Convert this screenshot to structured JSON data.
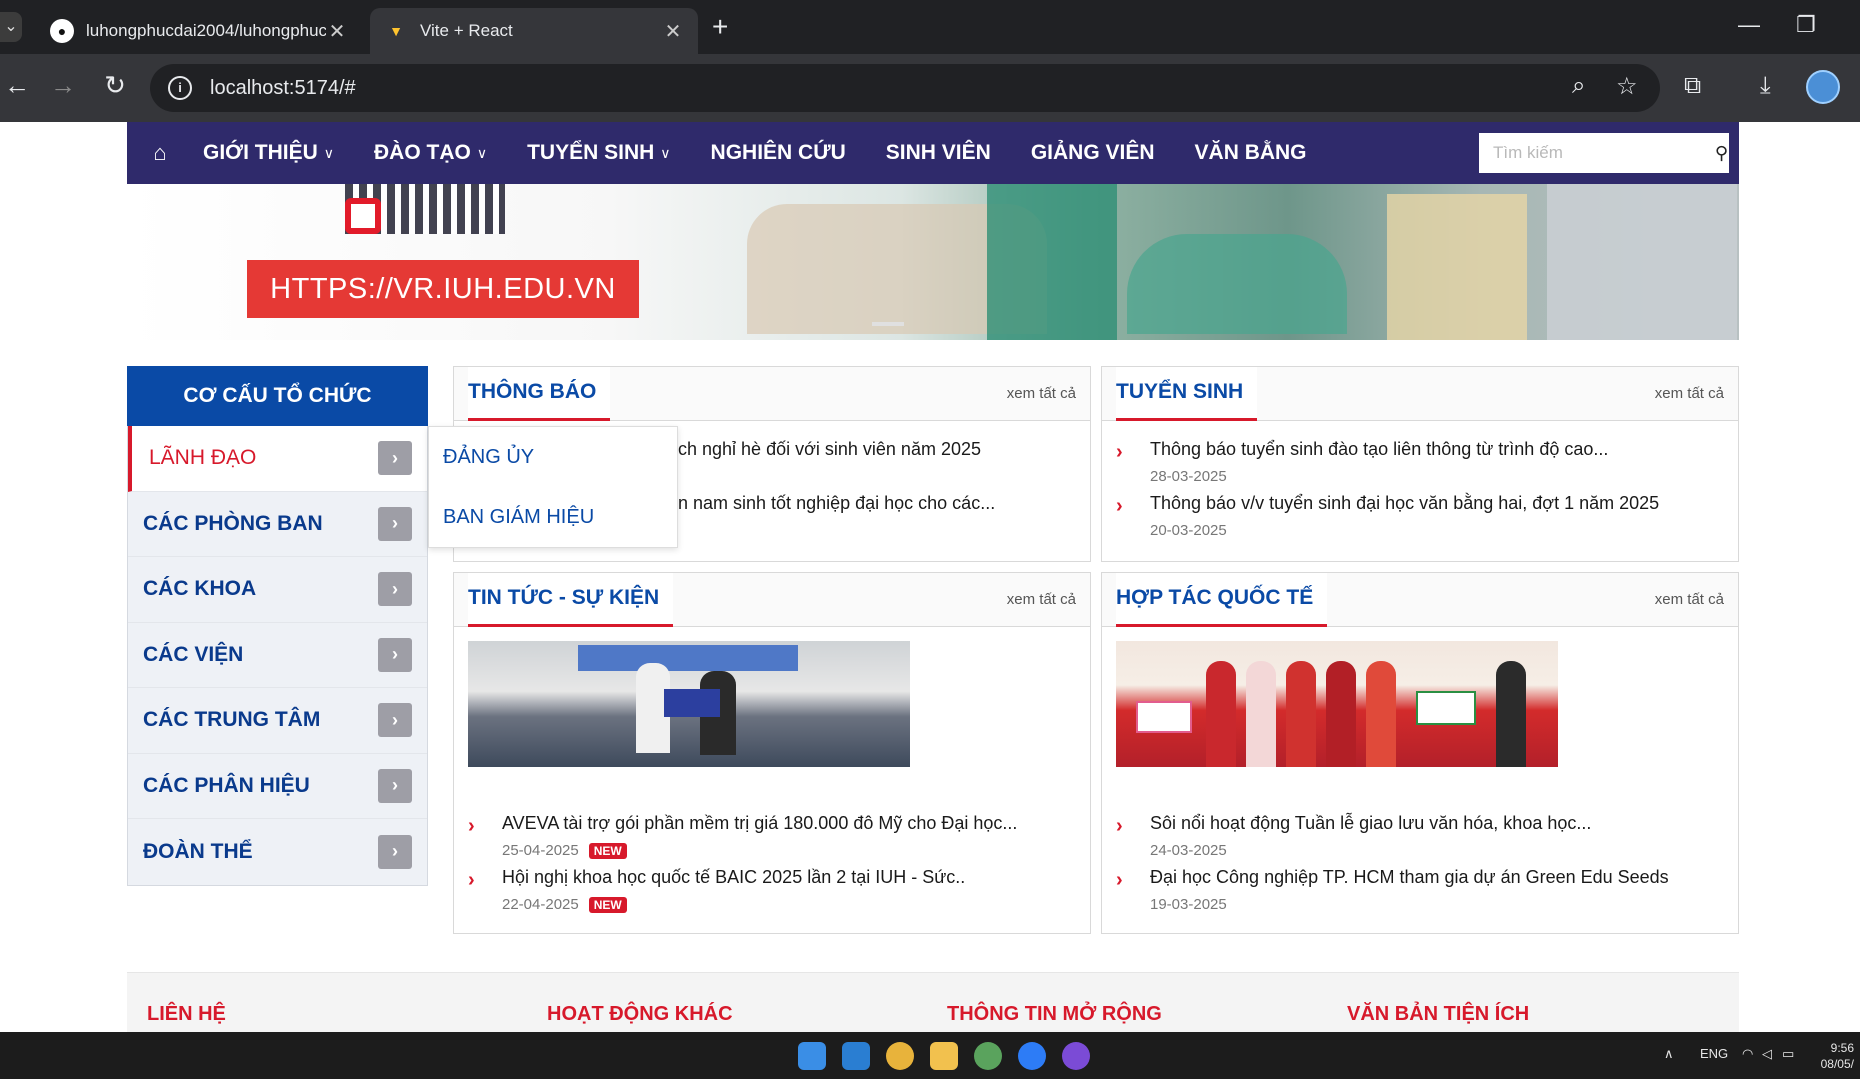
{
  "browser": {
    "tabs": [
      {
        "title": "luhongphucdai2004/luhongphucd",
        "active": false
      },
      {
        "title": "Vite + React",
        "active": true
      }
    ],
    "url": "localhost:5174/#"
  },
  "nav": {
    "items": [
      {
        "label": "GIỚI THIỆU",
        "dropdown": true
      },
      {
        "label": "ĐÀO TẠO",
        "dropdown": true
      },
      {
        "label": "TUYỂN SINH",
        "dropdown": true
      },
      {
        "label": "NGHIÊN CỨU",
        "dropdown": false
      },
      {
        "label": "SINH VIÊN",
        "dropdown": false
      },
      {
        "label": "GIẢNG VIÊN",
        "dropdown": false
      },
      {
        "label": "VĂN BẰNG",
        "dropdown": false
      }
    ],
    "search_placeholder": "Tìm kiếm"
  },
  "banner": {
    "vr_label": "HTTPS://VR.IUH.EDU.VN"
  },
  "sidebar": {
    "title": "CƠ CẤU TỔ CHỨC",
    "items": [
      "LÃNH ĐẠO",
      "CÁC PHÒNG BAN",
      "CÁC KHOA",
      "CÁC VIỆN",
      "CÁC TRUNG TÂM",
      "CÁC PHÂN HIỆU",
      "ĐOÀN THỂ"
    ],
    "submenu": [
      "ĐẢNG ỦY",
      "BAN GIÁM HIỆU"
    ]
  },
  "panels": {
    "more": "xem tất cả",
    "new_badge": "NEW",
    "thongbao": {
      "title": "THÔNG BÁO",
      "items": [
        {
          "text": "ch nghỉ hè đối với sinh viên năm 2025"
        },
        {
          "text": "n nam sinh tốt nghiệp đại học cho các..."
        }
      ]
    },
    "tuyensinh": {
      "title": "TUYỂN SINH",
      "items": [
        {
          "text": "Thông báo tuyển sinh đào tạo liên thông từ trình độ cao...",
          "date": "28-03-2025"
        },
        {
          "text": "Thông báo v/v tuyển sinh đại học văn bằng hai, đợt 1 năm 2025",
          "date": "20-03-2025"
        }
      ]
    },
    "tintuc": {
      "title": "TIN TỨC - SỰ KIỆN",
      "items": [
        {
          "text": "AVEVA tài trợ gói phần mềm trị giá 180.000 đô Mỹ cho Đại học...",
          "date": "25-04-2025"
        },
        {
          "text": "Hội nghị khoa học quốc tế BAIC 2025 lần 2 tại IUH - Sức..",
          "date": "22-04-2025"
        }
      ]
    },
    "hoptac": {
      "title": "HỢP TÁC QUỐC TẾ",
      "items": [
        {
          "text": "Sôi nổi hoạt động Tuần lễ giao lưu văn hóa, khoa học...",
          "date": "24-03-2025"
        },
        {
          "text": "Đại học Công nghiệp TP. HCM tham gia dự án Green Edu Seeds",
          "date": "19-03-2025"
        }
      ]
    }
  },
  "footer": {
    "columns": [
      "LIÊN HỆ",
      "HOẠT ĐỘNG KHÁC",
      "THÔNG TIN MỞ RỘNG",
      "VĂN BẢN TIỆN ÍCH"
    ]
  },
  "taskbar": {
    "lang": "ENG",
    "time": "9:56",
    "date": "08/05/"
  }
}
